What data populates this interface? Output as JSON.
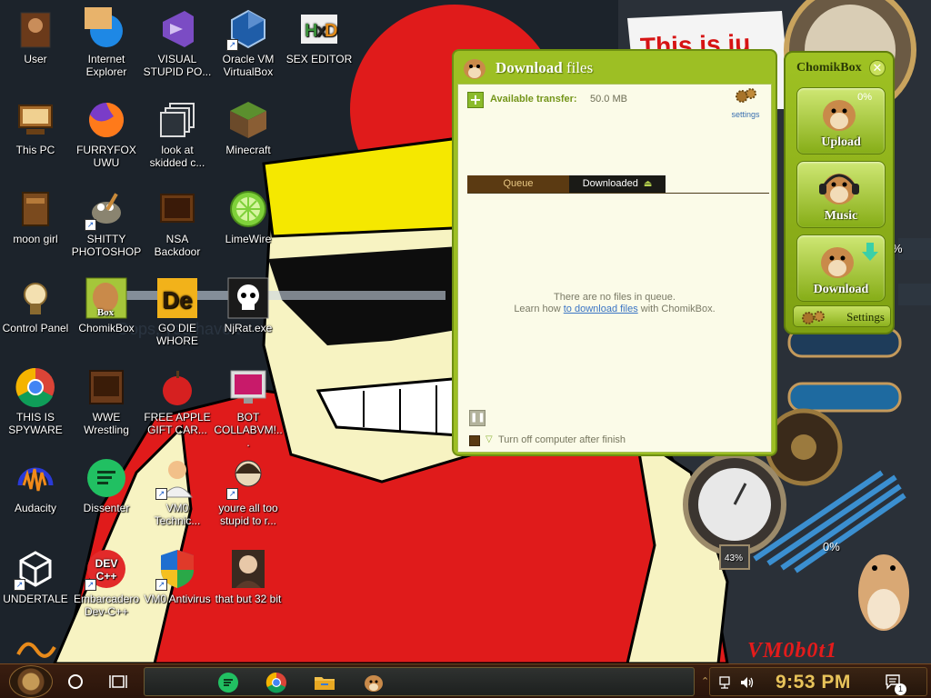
{
  "wallpaper": {
    "banner_text": "This is ju",
    "mid_text": "Oops, you have t",
    "signature": "VM0b0t1"
  },
  "desktop_icons": [
    {
      "label": "User",
      "icon": "user-folder-icon"
    },
    {
      "label": "Internet Explorer",
      "icon": "internet-explorer-icon"
    },
    {
      "label": "VISUAL STUPID PO...",
      "icon": "visual-studio-icon"
    },
    {
      "label": "Oracle VM VirtualBox",
      "icon": "virtualbox-icon"
    },
    {
      "label": "SEX EDITOR",
      "icon": "hxd-icon"
    },
    {
      "label": "This PC",
      "icon": "this-pc-icon"
    },
    {
      "label": "FURRYFOX UWU",
      "icon": "firefox-icon"
    },
    {
      "label": "look at skidded c...",
      "icon": "stacked-windows-icon"
    },
    {
      "label": "Minecraft",
      "icon": "minecraft-icon"
    },
    {
      "label": "moon girl",
      "icon": "moon-girl-icon"
    },
    {
      "label": "SHITTY PHOTOSHOP",
      "icon": "gimp-icon"
    },
    {
      "label": "NSA Backdoor",
      "icon": "nsa-backdoor-icon"
    },
    {
      "label": "LimeWire",
      "icon": "limewire-icon"
    },
    {
      "label": "Control Panel",
      "icon": "control-panel-icon"
    },
    {
      "label": "ChomikBox",
      "icon": "chomikbox-icon"
    },
    {
      "label": "GO DIE WHORE",
      "icon": "dexpot-icon"
    },
    {
      "label": "NjRat.exe",
      "icon": "skull-icon"
    },
    {
      "label": "THIS IS SPYWARE",
      "icon": "chrome-icon"
    },
    {
      "label": "WWE Wrestling",
      "icon": "wwe-icon"
    },
    {
      "label": "FREE APPLE GIFT CAR...",
      "icon": "apple-icon"
    },
    {
      "label": "BOT COLLABVM!...",
      "icon": "monitor-icon"
    },
    {
      "label": "Audacity",
      "icon": "audacity-icon"
    },
    {
      "label": "Dissenter",
      "icon": "dissenter-icon"
    },
    {
      "label": "VM0 Technic...",
      "icon": "technician-icon"
    },
    {
      "label": "youre all too stupid to r...",
      "icon": "portrait-icon"
    },
    {
      "label": "UNDERTALE",
      "icon": "unity-icon"
    },
    {
      "label": "Embarcadero Dev-C++",
      "icon": "devcpp-icon"
    },
    {
      "label": "VM0 Antivirus",
      "icon": "shield-icon"
    },
    {
      "label": "that but 32 bit",
      "icon": "lady-portrait-icon"
    }
  ],
  "download_window": {
    "title_bold": "Download",
    "title_rest": "files",
    "available_label": "Available transfer:",
    "available_value": "50.0 MB",
    "settings_label": "settings",
    "tabs": [
      {
        "label": "Queue",
        "active": true
      },
      {
        "label": "Downloaded",
        "active": false
      }
    ],
    "empty_line1": "There are no files in queue.",
    "empty_line2_pre": "Learn how",
    "empty_link": "to download files",
    "empty_line2_post": "with ChomikBox.",
    "turn_off_label": "Turn off computer after finish"
  },
  "chomikbox_sidebar": {
    "title": "ChomikBox",
    "upload_label": "Upload",
    "upload_percent": "0%",
    "music_label": "Music",
    "download_label": "Download",
    "settings_label": "Settings"
  },
  "gadgets": {
    "side_percent": "%",
    "transfer_percent": "0%",
    "gauge_value": "43%"
  },
  "taskbar": {
    "pinned": [
      "dissenter-icon",
      "chrome-icon",
      "file-explorer-icon",
      "chomikbox-icon"
    ],
    "clock": "9:53 PM",
    "notification_count": "1"
  },
  "colors": {
    "chomik_green": "#9dbf24",
    "taskbar_brown": "#3a1e10",
    "clock_gold": "#e8c35a",
    "wallpaper_red": "#e01b1b"
  }
}
